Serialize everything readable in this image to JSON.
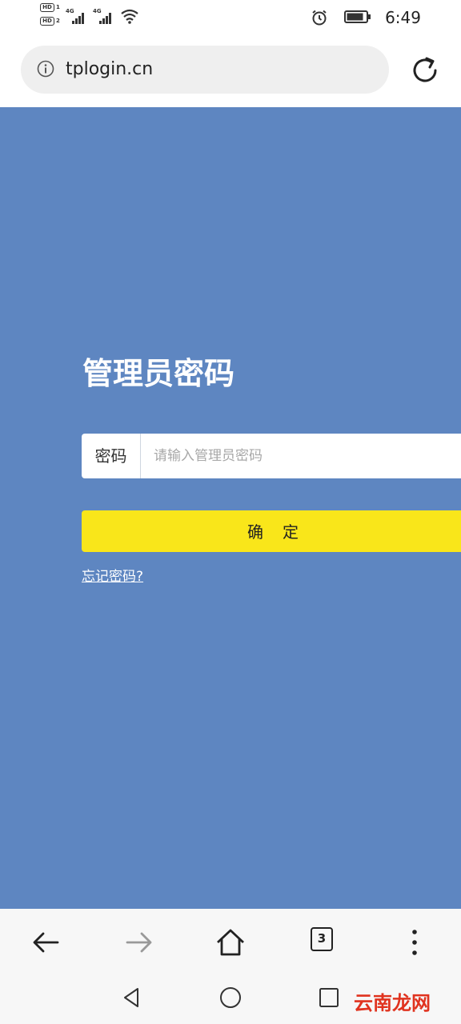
{
  "status_bar": {
    "time": "6:49",
    "network_type_1": "4G",
    "network_type_2": "4G",
    "hd_label": "HD"
  },
  "browser": {
    "url": "tplogin.cn",
    "tab_count": "3"
  },
  "page": {
    "title": "管理员密码",
    "password_label": "密码",
    "password_placeholder": "请输入管理员密码",
    "confirm_button": "确　定",
    "forgot_link": "忘记密码?"
  },
  "watermark": "云南龙网",
  "colors": {
    "page_background": "#5e86c1",
    "confirm_button": "#f9e61a",
    "watermark": "#e0331f"
  }
}
